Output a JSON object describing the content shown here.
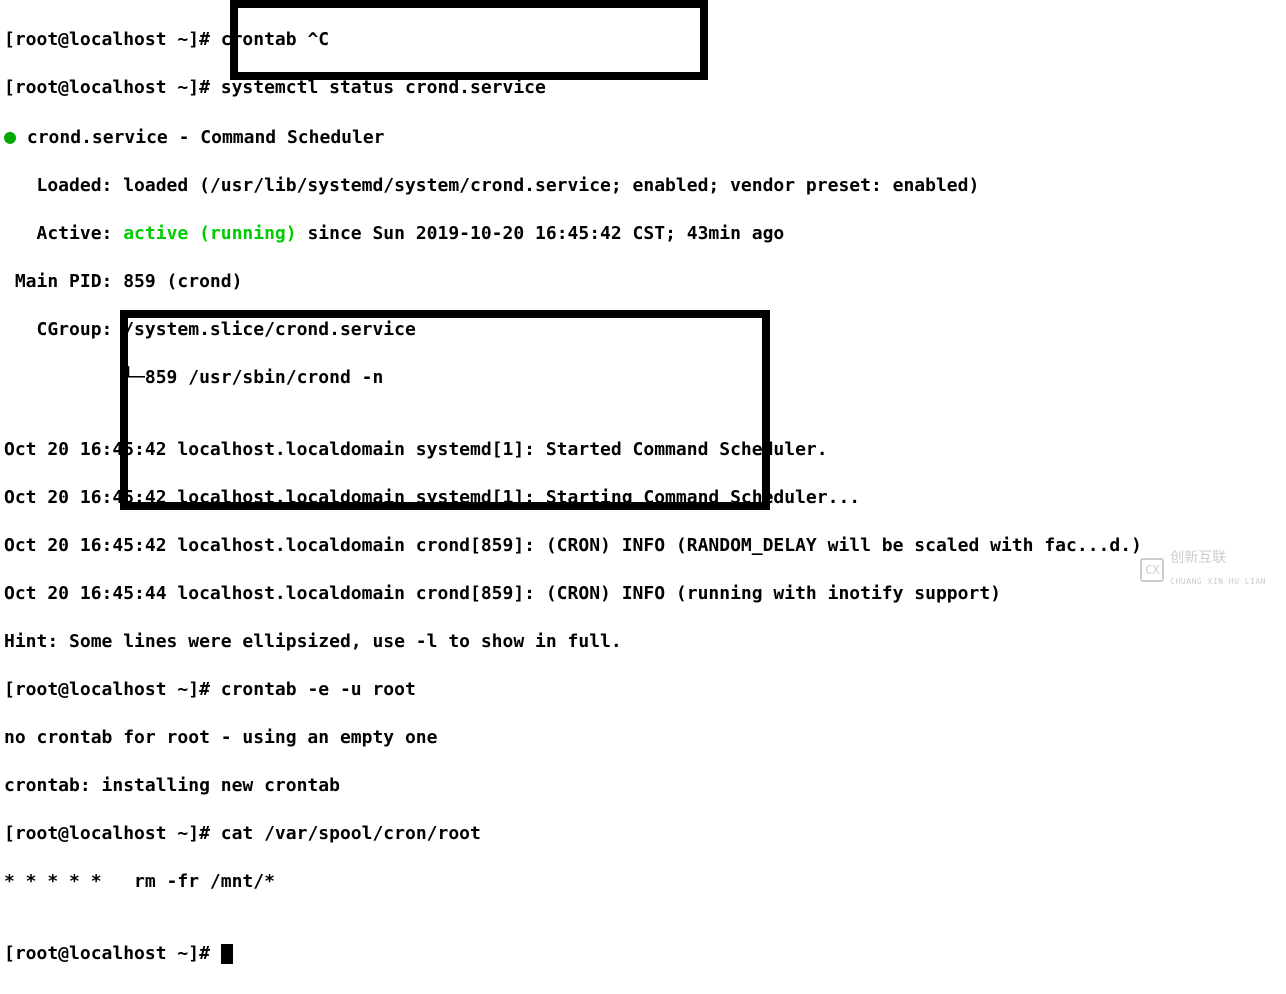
{
  "terminal": {
    "line1_prompt": "[root@localhost ~]# ",
    "line1_cmd": "crontab ^C",
    "line2_prompt": "[root@localhost ~]# ",
    "line2_cmd": "systemctl status crond.service",
    "line3_dot": "●",
    "line3_text": " crond.service - Command Scheduler",
    "line4": "   Loaded: loaded (/usr/lib/systemd/system/crond.service; enabled; vendor preset: enabled)",
    "line5_pre": "   Active: ",
    "line5_active": "active (running)",
    "line5_post": " since Sun 2019-10-20 16:45:42 CST; 43min ago",
    "line6": " Main PID: 859 (crond)",
    "line7": "   CGroup: /system.slice/crond.service",
    "line8": "           └─859 /usr/sbin/crond -n",
    "line9": "",
    "line10": "Oct 20 16:45:42 localhost.localdomain systemd[1]: Started Command Scheduler.",
    "line11": "Oct 20 16:45:42 localhost.localdomain systemd[1]: Starting Command Scheduler...",
    "line12": "Oct 20 16:45:42 localhost.localdomain crond[859]: (CRON) INFO (RANDOM_DELAY will be scaled with fac...d.)",
    "line13": "Oct 20 16:45:44 localhost.localdomain crond[859]: (CRON) INFO (running with inotify support)",
    "line14": "Hint: Some lines were ellipsized, use -l to show in full.",
    "line15_prompt": "[root@localhost ~]# ",
    "line15_cmd": "crontab -e -u root",
    "line16": "no crontab for root - using an empty one",
    "line17": "crontab: installing new crontab",
    "line18_prompt": "[root@localhost ~]# ",
    "line18_cmd": "cat /var/spool/cron/root",
    "line19": "* * * * *   rm -fr /mnt/*",
    "line20": "",
    "line21_prompt": "[root@localhost ~]# "
  },
  "watermark": {
    "text": "创新互联",
    "subtext": "CHUANG XIN HU LIAN",
    "icon": "CX"
  }
}
